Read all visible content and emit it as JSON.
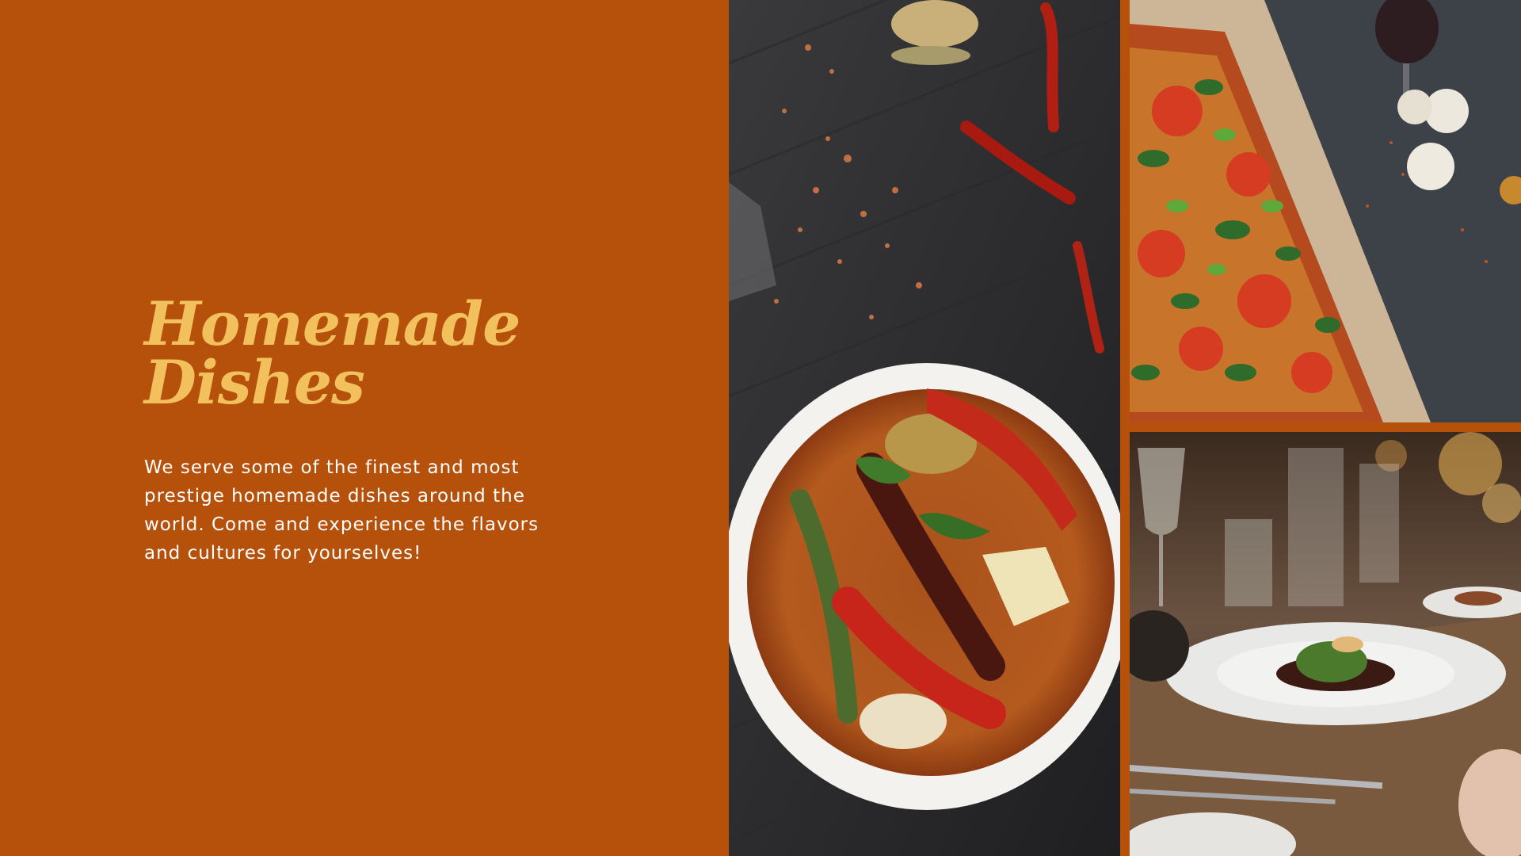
{
  "slide": {
    "title_line1": "Homemade",
    "title_line2": "Dishes",
    "description": "We serve some of the finest and most prestige homemade dishes around the world. Come and experience the flavors and cultures for yourselves!"
  },
  "colors": {
    "background": "#b5510b",
    "title": "#f2c05c",
    "body_text": "#ffffff"
  },
  "photos": [
    {
      "subject": "curry-bowl-with-chilies"
    },
    {
      "subject": "vegetable-pizza-on-parchment"
    },
    {
      "subject": "restaurant-dinner-table"
    }
  ]
}
